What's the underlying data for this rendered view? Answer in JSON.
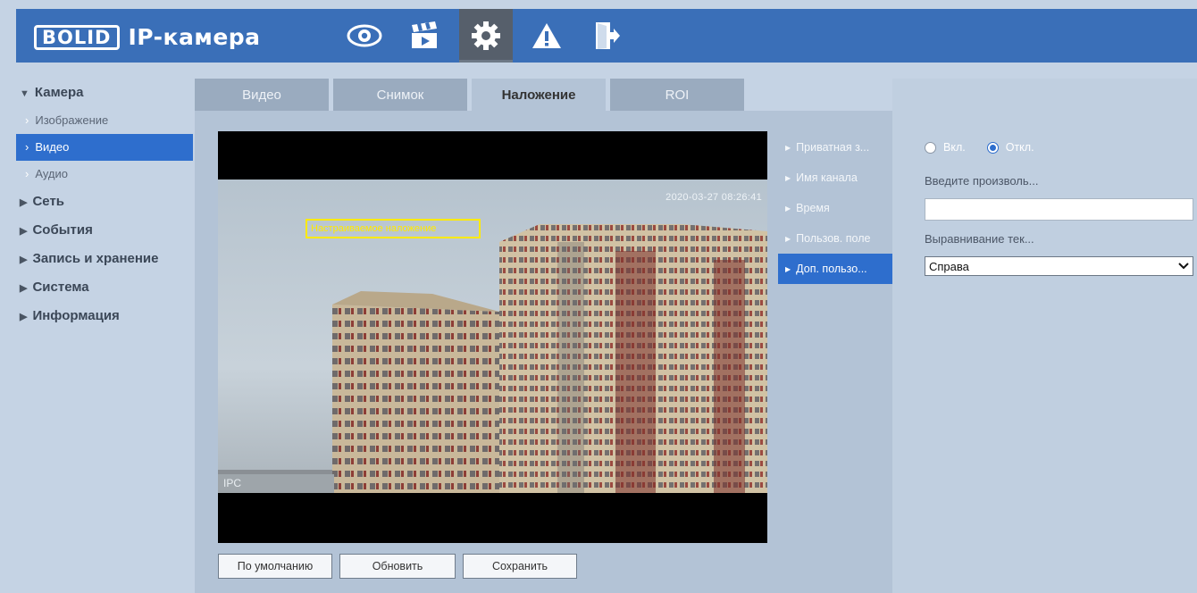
{
  "header": {
    "logo": "BOLID",
    "title": "IP-камера",
    "nav": [
      {
        "icon": "eye-icon"
      },
      {
        "icon": "clapperboard-icon"
      },
      {
        "icon": "gear-icon",
        "active": true
      },
      {
        "icon": "warning-icon"
      },
      {
        "icon": "logout-icon"
      }
    ],
    "accent_color": "#3a6fb8"
  },
  "sidebar": {
    "groups": [
      {
        "label": "Камера",
        "expanded": true,
        "items": [
          {
            "label": "Изображение"
          },
          {
            "label": "Видео",
            "active": true
          },
          {
            "label": "Аудио"
          }
        ]
      },
      {
        "label": "Сеть"
      },
      {
        "label": "События"
      },
      {
        "label": "Запись и хранение"
      },
      {
        "label": "Система"
      },
      {
        "label": "Информация"
      }
    ]
  },
  "tabs": [
    {
      "label": "Видео"
    },
    {
      "label": "Снимок"
    },
    {
      "label": "Наложение",
      "active": true
    },
    {
      "label": "ROI"
    }
  ],
  "preview": {
    "timestamp": "2020-03-27 08:26:41",
    "custom_overlay": "Настраиваемое наложение",
    "channel": "IPC"
  },
  "overlay_list": [
    {
      "label": "Приватная з..."
    },
    {
      "label": "Имя канала"
    },
    {
      "label": "Время"
    },
    {
      "label": "Пользов. поле"
    },
    {
      "label": "Доп. пользо...",
      "active": true
    }
  ],
  "settings": {
    "on_label": "Вкл.",
    "off_label": "Откл.",
    "selected": "off",
    "text_label": "Введите произволь...",
    "text_value": "",
    "align_label": "Выравнивание тек...",
    "align_value": "Справа"
  },
  "buttons": {
    "default": "По умолчанию",
    "refresh": "Обновить",
    "save": "Сохранить"
  }
}
